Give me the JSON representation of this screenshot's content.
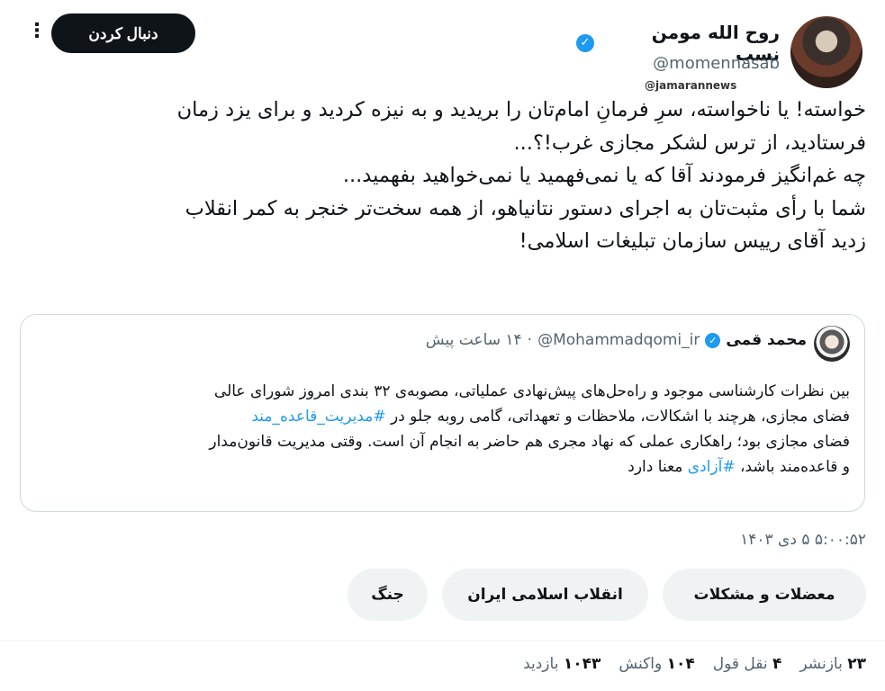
{
  "header": {
    "display_name": "روح الله مومن نسب",
    "handle": "@momennasab",
    "watermark": "@jamarannews",
    "follow_label": "دنبال کردن",
    "more_icon": "more-vertical-icon",
    "verified_icon": "verified-badge-icon",
    "verified_color": "#1d9bf0"
  },
  "tweet": {
    "lines": [
      "خواسته! یا ناخواسته، سرِ فرمانِ امام‌تان را بریدید و به نیزه کردید و برای یزد زمان",
      "فرستادید، از ترس لشکر مجازی غرب!؟...",
      "چه غم‌انگیز فرمودند آقا که یا نمی‌فهمید یا نمی‌خواهید بفهمید...",
      "شما با رأی مثبت‌تان به اجرای دستور نتانیاهو، از همه سخت‌تر خنجر به کمر انقلاب",
      "زدید آقای رییس سازمان تبلیغات اسلامی!"
    ]
  },
  "quote": {
    "name": "محمد قمی",
    "handle": "@Mohammadqomi_ir",
    "dot": "·",
    "time": "۱۴ ساعت پیش",
    "line1": "بین نظرات کارشناسی موجود و راه‌حل‌های پیش‌نهادی عملیاتی، مصوبه‌ی ۳۲ بندی امروز شورای عالی",
    "line2_text": "فضای مجازی، هرچند با اشکالات، ملاحظات و تعهداتی، گامی روبه جلو در ",
    "line2_hashtag": "#مدیریت_قاعده_مند",
    "line3": "فضای مجازی بود؛ راهکاری عملی که نهاد مجری هم حاضر به انجام آن است. وقتی مدیریت قانون‌مدار",
    "line4_text_a": "و قاعده‌مند باشد، ",
    "line4_hashtag": "#آزادی",
    "line4_text_b": " معنا دارد"
  },
  "meta": {
    "timestamp": "۵:۰۰:۵۲ ۵ دی ۱۴۰۳"
  },
  "topics": [
    "معضلات و مشکلات",
    "انقلاب اسلامی ایران",
    "جنگ"
  ],
  "stats": {
    "reposts_count": "۲۳",
    "reposts_label": "بازنشر",
    "quotes_count": "۴",
    "quotes_label": "نقل قول",
    "likes_count": "۱۰۴",
    "likes_label": "واکنش",
    "views_count": "۱۰۴۳",
    "views_label": "بازدید"
  }
}
